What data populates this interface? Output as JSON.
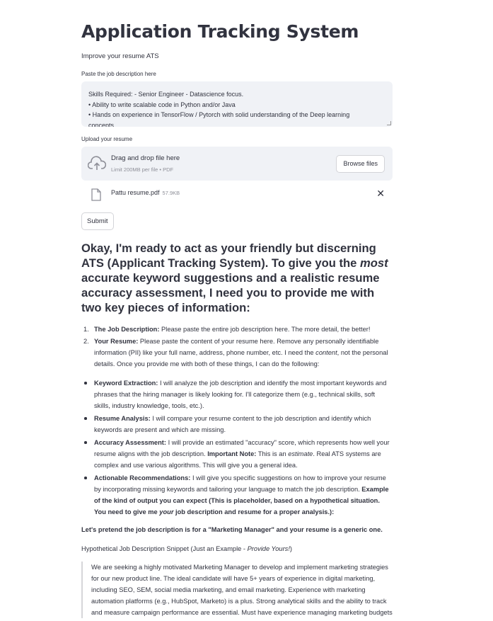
{
  "header": {
    "title": "Application Tracking System",
    "subtitle": "Improve your resume ATS"
  },
  "job_description": {
    "label": "Paste the job description here",
    "lines": [
      "Skills Required: - Senior Engineer - Datascience focus.",
      "• Ability to write scalable code in Python and/or Java",
      "• Hands on experience in TensorFlow / Pytorch with solid understanding of the Deep learning",
      "concepts"
    ]
  },
  "uploader": {
    "label": "Upload your resume",
    "drop_text": "Drag and drop file here",
    "limit_text": "Limit 200MB per file • PDF",
    "browse_label": "Browse files",
    "file_name": "Pattu resume.pdf",
    "file_size": "57.9KB",
    "remove_icon": "close-icon"
  },
  "submit_label": "Submit",
  "response": {
    "intro_1": "Okay, I'm ready to act as your friendly but discerning ATS (Applicant Tracking System). To give you the ",
    "intro_em": "most",
    "intro_2": " accurate keyword suggestions and a realistic resume accuracy assessment, I need you to provide me with two key pieces of information:",
    "ordered": [
      {
        "num": "1.",
        "bold": "The Job Description:",
        "text": " Please paste the entire job description here. The more detail, the better!"
      },
      {
        "num": "2.",
        "bold": "Your Resume:",
        "text_1": " Please paste the content of your resume here. Remove any personally identifiable information (PII) like your full name, address, phone number, etc. I need the ",
        "em": "content",
        "text_2": ", not the personal details. Once you provide me with both of these things, I can do the following:"
      }
    ],
    "bullets": [
      {
        "bold": "Keyword Extraction:",
        "text": " I will analyze the job description and identify the most important keywords and phrases that the hiring manager is likely looking for. I'll categorize them (e.g., technical skills, soft skills, industry knowledge, tools, etc.)."
      },
      {
        "bold": "Resume Analysis:",
        "text": " I will compare your resume content to the job description and identify which keywords are present and which are missing."
      },
      {
        "bold": "Accuracy Assessment:",
        "text_1": " I will provide an estimated \"accuracy\" score, which represents how well your resume aligns with the job description. ",
        "bold_2": "Important Note:",
        "text_2": " This is an ",
        "em": "estimate",
        "text_3": ". Real ATS systems are complex and use various algorithms. This will give you a general idea."
      },
      {
        "bold": "Actionable Recommendations:",
        "text_1": " I will give you specific suggestions on how to improve your resume by incorporating missing keywords and tailoring your language to match the job description. ",
        "bold_2": "Example of the kind of output you can expect (This is placeholder, based on a hypothetical situation. You need to give me ",
        "bold_em": "your",
        "bold_3": " job description and resume for a proper analysis.):"
      }
    ],
    "pretend": "Let's pretend the job description is for a \"Marketing Manager\" and your resume is a generic one.",
    "snippet_heading": "Hypothetical Job Description Snippet (Just an Example - ",
    "snippet_heading_em": "Provide Yours!",
    "snippet_heading_end": ")",
    "quote": "We are seeking a highly motivated Marketing Manager to develop and implement marketing strategies for our new product line. The ideal candidate will have 5+ years of experience in digital marketing, including SEO, SEM, social media marketing, and email marketing. Experience with marketing automation platforms (e.g., HubSpot, Marketo) is a plus. Strong analytical skills and the ability to track and measure campaign performance are essential. Must have experience managing marketing budgets"
  }
}
